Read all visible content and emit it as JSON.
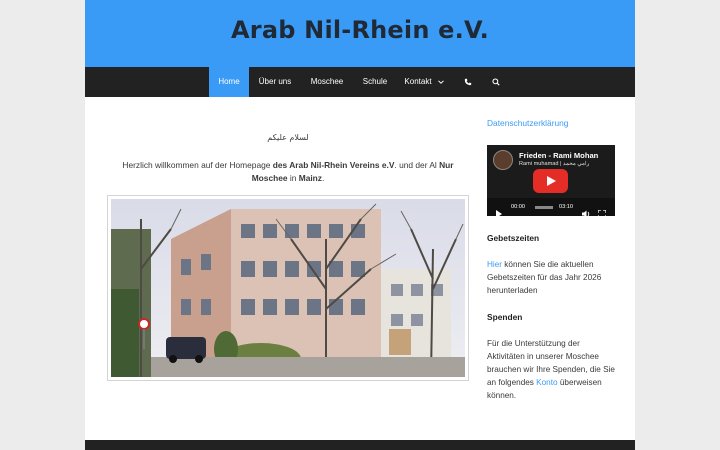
{
  "site": {
    "title": "Arab Nil-Rhein e.V."
  },
  "nav": {
    "items": [
      {
        "label": "Home",
        "active": true
      },
      {
        "label": "Über uns"
      },
      {
        "label": "Moschee"
      },
      {
        "label": "Schule"
      },
      {
        "label": "Kontakt"
      }
    ],
    "icons": [
      "chevron-down-icon",
      "phone-icon",
      "search-icon"
    ]
  },
  "main": {
    "greeting_ar": "لسلام عليكم",
    "welcome": {
      "part1": "Herzlich willkommen auf der Homepage ",
      "bold1": "des Arab Nil-Rhein Vereins e.V",
      "part2": ". und der  Al ",
      "bold2": "Nur Moschee",
      "part3": " in ",
      "bold3": "Mainz",
      "part4": "."
    },
    "photo_alt": "Moschee Gebäude"
  },
  "sidebar": {
    "privacy_link": "Datenschutzerklärung",
    "video": {
      "title": "Frieden - Rami Mohan",
      "subtitle": "Rami muhamad | رامي محمد",
      "time_current": "00:00",
      "time_total": "03:10"
    },
    "prayer": {
      "heading": "Gebetszeiten",
      "link": "Hier",
      "text": " können Sie die aktuellen Gebetszeiten für das Jahr 2026 herunterladen"
    },
    "donation": {
      "heading": "Spenden",
      "text1": "Für die Unterstützung der Aktivitäten in unserer Moschee brauchen wir Ihre Spenden, die Sie an folgendes ",
      "link": "Konto",
      "text2": " überweisen können."
    }
  },
  "colors": {
    "header": "#3a9bf6",
    "nav": "#222222",
    "accent": "#3a9bf6"
  }
}
